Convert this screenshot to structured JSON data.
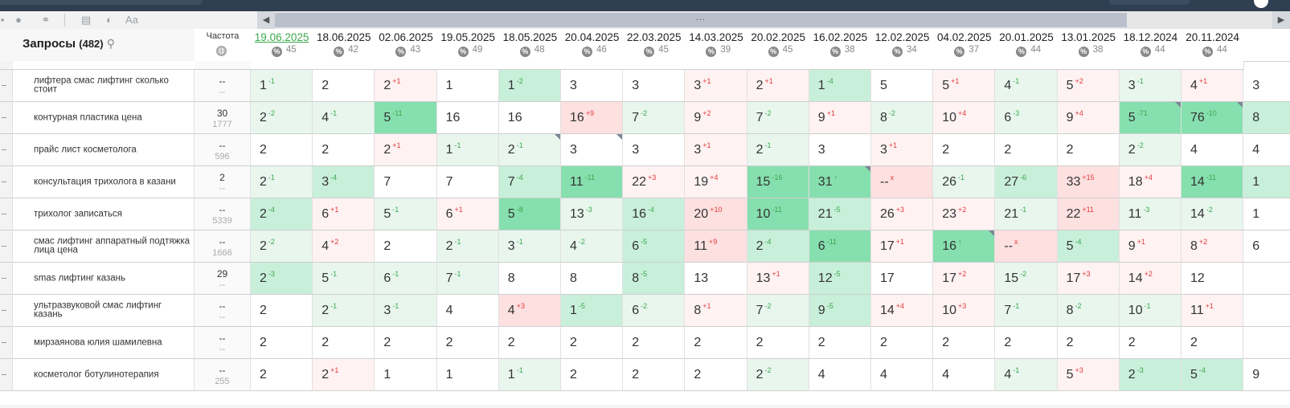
{
  "header": {
    "query_title": "Запросы",
    "query_count": "(482)",
    "freq_label": "Частота"
  },
  "toolbar": {
    "icons": [
      "link-icon",
      "table-icon",
      "contrast-icon",
      "text-icon"
    ]
  },
  "dates": [
    {
      "date": "19.06.2025",
      "top": "45"
    },
    {
      "date": "18.06.2025",
      "top": "42"
    },
    {
      "date": "02.06.2025",
      "top": "43"
    },
    {
      "date": "19.05.2025",
      "top": "49"
    },
    {
      "date": "18.05.2025",
      "top": "48"
    },
    {
      "date": "20.04.2025",
      "top": "46"
    },
    {
      "date": "22.03.2025",
      "top": "45"
    },
    {
      "date": "14.03.2025",
      "top": "39"
    },
    {
      "date": "20.02.2025",
      "top": "45"
    },
    {
      "date": "16.02.2025",
      "top": "38"
    },
    {
      "date": "12.02.2025",
      "top": "34"
    },
    {
      "date": "04.02.2025",
      "top": "37"
    },
    {
      "date": "20.01.2025",
      "top": "44"
    },
    {
      "date": "13.01.2025",
      "top": "38"
    },
    {
      "date": "18.12.2024",
      "top": "44"
    },
    {
      "date": "20.11.2024",
      "top": "44"
    }
  ],
  "rows": [
    {
      "query": "лифтера смас лифтинг сколько стоит",
      "f1": "--",
      "f2": "--",
      "cells": [
        [
          "1",
          "-1",
          "g",
          1
        ],
        [
          "2",
          "",
          "",
          0
        ],
        [
          "2",
          "+1",
          "r",
          1
        ],
        [
          "1",
          "",
          "",
          0
        ],
        [
          "1",
          "-2",
          "g",
          2
        ],
        [
          "3",
          "",
          "",
          0
        ],
        [
          "3",
          "",
          "",
          0
        ],
        [
          "3",
          "+1",
          "r",
          1
        ],
        [
          "2",
          "+1",
          "r",
          1
        ],
        [
          "1",
          "-4",
          "g",
          2
        ],
        [
          "5",
          "",
          "",
          0
        ],
        [
          "5",
          "+1",
          "r",
          1
        ],
        [
          "4",
          "-1",
          "g",
          1
        ],
        [
          "5",
          "+2",
          "r",
          1
        ],
        [
          "3",
          "-1",
          "g",
          1
        ],
        [
          "4",
          "+1",
          "r",
          1
        ]
      ]
    },
    {
      "query": "контурная пластика цена",
      "f1": "30",
      "f2": "1777",
      "cells": [
        [
          "2",
          "-2",
          "g",
          1
        ],
        [
          "4",
          "-1",
          "g",
          1
        ],
        [
          "5",
          "-11",
          "g",
          3
        ],
        [
          "16",
          "",
          "",
          0
        ],
        [
          "16",
          "",
          "",
          0
        ],
        [
          "16",
          "+9",
          "r",
          2
        ],
        [
          "7",
          "-2",
          "g",
          1
        ],
        [
          "9",
          "+2",
          "r",
          1
        ],
        [
          "7",
          "-2",
          "g",
          1
        ],
        [
          "9",
          "+1",
          "r",
          1
        ],
        [
          "8",
          "-2",
          "g",
          1
        ],
        [
          "10",
          "+4",
          "r",
          1
        ],
        [
          "6",
          "-3",
          "g",
          1
        ],
        [
          "9",
          "+4",
          "r",
          1
        ],
        [
          "5",
          "-71",
          "g",
          3,
          "flag"
        ],
        [
          "76",
          "-10",
          "g",
          3,
          "flag"
        ]
      ]
    },
    {
      "query": "прайс лист косметолога",
      "f1": "--",
      "f2": "596",
      "cells": [
        [
          "2",
          "",
          "",
          0
        ],
        [
          "2",
          "",
          "",
          0
        ],
        [
          "2",
          "+1",
          "r",
          1
        ],
        [
          "1",
          "-1",
          "g",
          1
        ],
        [
          "2",
          "-1",
          "g",
          1,
          "flag"
        ],
        [
          "3",
          "",
          "",
          0,
          "flag"
        ],
        [
          "3",
          "",
          "",
          0
        ],
        [
          "3",
          "+1",
          "r",
          1
        ],
        [
          "2",
          "-1",
          "g",
          1
        ],
        [
          "3",
          "",
          "",
          0
        ],
        [
          "3",
          "+1",
          "r",
          1
        ],
        [
          "2",
          "",
          "",
          0
        ],
        [
          "2",
          "",
          "",
          0
        ],
        [
          "2",
          "",
          "",
          0
        ],
        [
          "2",
          "-2",
          "g",
          1
        ],
        [
          "4",
          "",
          "",
          0
        ]
      ]
    },
    {
      "query": "консультация трихолога в казани",
      "f1": "2",
      "f2": "--",
      "cells": [
        [
          "2",
          "-1",
          "g",
          1
        ],
        [
          "3",
          "-4",
          "g",
          2
        ],
        [
          "7",
          "",
          "",
          0
        ],
        [
          "7",
          "",
          "",
          0
        ],
        [
          "7",
          "-4",
          "g",
          2
        ],
        [
          "11",
          "-11",
          "g",
          3
        ],
        [
          "22",
          "+3",
          "r",
          1
        ],
        [
          "19",
          "+4",
          "r",
          1
        ],
        [
          "15",
          "-16",
          "g",
          3
        ],
        [
          "31",
          "↑",
          "g",
          3,
          "flag"
        ],
        [
          "--",
          "x",
          "r",
          2
        ],
        [
          "26",
          "-1",
          "g",
          1
        ],
        [
          "27",
          "-6",
          "g",
          2
        ],
        [
          "33",
          "+15",
          "r",
          2
        ],
        [
          "18",
          "+4",
          "r",
          1
        ],
        [
          "14",
          "-11",
          "g",
          3
        ]
      ]
    },
    {
      "query": "трихолог записаться",
      "f1": "--",
      "f2": "5339",
      "cells": [
        [
          "2",
          "-4",
          "g",
          2
        ],
        [
          "6",
          "+1",
          "r",
          1
        ],
        [
          "5",
          "-1",
          "g",
          1
        ],
        [
          "6",
          "+1",
          "r",
          1
        ],
        [
          "5",
          "-8",
          "g",
          3
        ],
        [
          "13",
          "-3",
          "g",
          1
        ],
        [
          "16",
          "-4",
          "g",
          2
        ],
        [
          "20",
          "+10",
          "r",
          2
        ],
        [
          "10",
          "-11",
          "g",
          3
        ],
        [
          "21",
          "-5",
          "g",
          2
        ],
        [
          "26",
          "+3",
          "r",
          1
        ],
        [
          "23",
          "+2",
          "r",
          1
        ],
        [
          "21",
          "-1",
          "g",
          1
        ],
        [
          "22",
          "+11",
          "r",
          2
        ],
        [
          "11",
          "-3",
          "g",
          1
        ],
        [
          "14",
          "-2",
          "g",
          1
        ]
      ]
    },
    {
      "query": "смас лифтинг аппаратный подтяжка лица цена",
      "f1": "--",
      "f2": "1666",
      "cells": [
        [
          "2",
          "-2",
          "g",
          1
        ],
        [
          "4",
          "+2",
          "r",
          1
        ],
        [
          "2",
          "",
          "",
          0
        ],
        [
          "2",
          "-1",
          "g",
          1
        ],
        [
          "3",
          "-1",
          "g",
          1
        ],
        [
          "4",
          "-2",
          "g",
          1
        ],
        [
          "6",
          "-5",
          "g",
          2
        ],
        [
          "11",
          "+9",
          "r",
          2
        ],
        [
          "2",
          "-4",
          "g",
          2
        ],
        [
          "6",
          "-11",
          "g",
          3
        ],
        [
          "17",
          "+1",
          "r",
          1
        ],
        [
          "16",
          "↑",
          "g",
          3,
          "flag"
        ],
        [
          "--",
          "x",
          "r",
          2
        ],
        [
          "5",
          "-4",
          "g",
          2
        ],
        [
          "9",
          "+1",
          "r",
          1
        ],
        [
          "8",
          "+2",
          "r",
          1
        ]
      ]
    },
    {
      "query": "smas лифтинг казань",
      "f1": "29",
      "f2": "--",
      "cells": [
        [
          "2",
          "-3",
          "g",
          2
        ],
        [
          "5",
          "-1",
          "g",
          1
        ],
        [
          "6",
          "-1",
          "g",
          1
        ],
        [
          "7",
          "-1",
          "g",
          1
        ],
        [
          "8",
          "",
          "",
          0
        ],
        [
          "8",
          "",
          "",
          0
        ],
        [
          "8",
          "-5",
          "g",
          2
        ],
        [
          "13",
          "",
          "",
          0
        ],
        [
          "13",
          "+1",
          "r",
          1
        ],
        [
          "12",
          "-5",
          "g",
          2
        ],
        [
          "17",
          "",
          "",
          0
        ],
        [
          "17",
          "+2",
          "r",
          1
        ],
        [
          "15",
          "-2",
          "g",
          1
        ],
        [
          "17",
          "+3",
          "r",
          1
        ],
        [
          "14",
          "+2",
          "r",
          1
        ],
        [
          "12",
          "",
          "",
          0
        ]
      ]
    },
    {
      "query": "ультразвуковой смас лифтинг казань",
      "f1": "--",
      "f2": "--",
      "cells": [
        [
          "2",
          "",
          "",
          0
        ],
        [
          "2",
          "-1",
          "g",
          1
        ],
        [
          "3",
          "-1",
          "g",
          1
        ],
        [
          "4",
          "",
          "",
          0
        ],
        [
          "4",
          "+3",
          "r",
          2
        ],
        [
          "1",
          "-5",
          "g",
          2
        ],
        [
          "6",
          "-2",
          "g",
          1
        ],
        [
          "8",
          "+1",
          "r",
          1
        ],
        [
          "7",
          "-2",
          "g",
          1
        ],
        [
          "9",
          "-5",
          "g",
          2
        ],
        [
          "14",
          "+4",
          "r",
          1
        ],
        [
          "10",
          "+3",
          "r",
          1
        ],
        [
          "7",
          "-1",
          "g",
          1
        ],
        [
          "8",
          "-2",
          "g",
          1
        ],
        [
          "10",
          "-1",
          "g",
          1
        ],
        [
          "11",
          "+1",
          "r",
          1
        ]
      ]
    },
    {
      "query": "мирзаянова юлия шамилевна",
      "f1": "--",
      "f2": "--",
      "cells": [
        [
          "2",
          "",
          "",
          0
        ],
        [
          "2",
          "",
          "",
          0
        ],
        [
          "2",
          "",
          "",
          0
        ],
        [
          "2",
          "",
          "",
          0
        ],
        [
          "2",
          "",
          "",
          0
        ],
        [
          "2",
          "",
          "",
          0
        ],
        [
          "2",
          "",
          "",
          0
        ],
        [
          "2",
          "",
          "",
          0
        ],
        [
          "2",
          "",
          "",
          0
        ],
        [
          "2",
          "",
          "",
          0
        ],
        [
          "2",
          "",
          "",
          0
        ],
        [
          "2",
          "",
          "",
          0
        ],
        [
          "2",
          "",
          "",
          0
        ],
        [
          "2",
          "",
          "",
          0
        ],
        [
          "2",
          "",
          "",
          0
        ],
        [
          "2",
          "",
          "",
          0
        ]
      ]
    },
    {
      "query": "косметолог ботулинотерапия",
      "f1": "--",
      "f2": "255",
      "cells": [
        [
          "2",
          "",
          "",
          0
        ],
        [
          "2",
          "+1",
          "r",
          1
        ],
        [
          "1",
          "",
          "",
          0
        ],
        [
          "1",
          "",
          "",
          0
        ],
        [
          "1",
          "-1",
          "g",
          1
        ],
        [
          "2",
          "",
          "",
          0
        ],
        [
          "2",
          "",
          "",
          0
        ],
        [
          "2",
          "",
          "",
          0
        ],
        [
          "2",
          "-2",
          "g",
          1
        ],
        [
          "4",
          "",
          "",
          0
        ],
        [
          "4",
          "",
          "",
          0
        ],
        [
          "4",
          "",
          "",
          0
        ],
        [
          "4",
          "-1",
          "g",
          1
        ],
        [
          "5",
          "+3",
          "r",
          1
        ],
        [
          "2",
          "-3",
          "g",
          2
        ],
        [
          "5",
          "-4",
          "g",
          2
        ]
      ]
    }
  ],
  "partial_col_values": [
    "3",
    "8",
    "4",
    "1",
    "1",
    "6",
    "",
    "",
    "",
    "9"
  ]
}
